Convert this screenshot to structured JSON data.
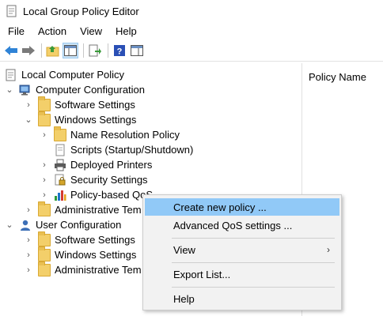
{
  "window": {
    "title": "Local Group Policy Editor",
    "icon": "policy-editor-icon"
  },
  "menu": [
    "File",
    "Action",
    "View",
    "Help"
  ],
  "toolbar": {
    "buttons": [
      "back-arrow-icon",
      "forward-arrow-icon",
      "up-folder-icon",
      "show-hide-tree-icon",
      "export-list-icon",
      "help-icon",
      "show-hide-action-pane-icon"
    ]
  },
  "tree": {
    "root": "Local Computer Policy",
    "computer_config": "Computer Configuration",
    "cc_software": "Software Settings",
    "cc_windows": "Windows Settings",
    "name_resolution": "Name Resolution Policy",
    "scripts": "Scripts (Startup/Shutdown)",
    "deployed_printers": "Deployed Printers",
    "security": "Security Settings",
    "qos": "Policy-based QoS",
    "cc_admin": "Administrative Tem",
    "user_config": "User Configuration",
    "uc_software": "Software Settings",
    "uc_windows": "Windows Settings",
    "uc_admin": "Administrative Tem"
  },
  "right_pane": {
    "column_header": "Policy Name"
  },
  "context_menu": {
    "create": "Create new policy ...",
    "advanced": "Advanced QoS settings ...",
    "view": "View",
    "export": "Export List...",
    "help": "Help"
  },
  "colors": {
    "highlight": "#91c9f7",
    "folder": "#f3cf6a",
    "accent_blue": "#1e74c7"
  }
}
